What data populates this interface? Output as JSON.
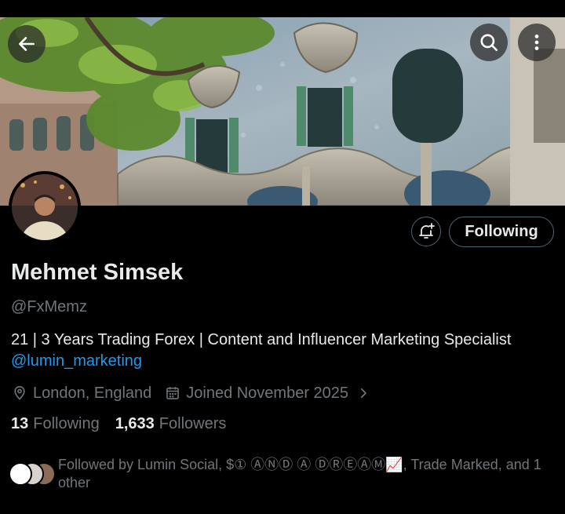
{
  "profile": {
    "name": "Mehmet Simsek",
    "handle": "@FxMemz",
    "bio": "21 | 3 Years Trading Forex | Content and Influencer Marketing Specialist",
    "bio_mention": "@lumin_marketing",
    "location": "London, England",
    "joined": "Joined November 2025",
    "following_count": "13",
    "following_label": "Following",
    "followers_count": "1,633",
    "followers_label": "Followers"
  },
  "actions": {
    "follow_state_label": "Following"
  },
  "followed_by": {
    "text": "Followed by Lumin Social, $① ⒶⓃⒹ Ⓐ ⒹⓇⒺⒶⓂ📈, Trade Marked, and 1 other"
  },
  "icons": {
    "back": "arrow-left-icon",
    "search": "search-icon",
    "more": "more-vertical-icon",
    "notify": "bell-plus-icon",
    "location": "location-pin-icon",
    "calendar": "calendar-icon",
    "expand": "chevron-right-icon"
  },
  "colors": {
    "background": "#000000",
    "text_primary": "#e7e9ea",
    "text_secondary": "#71767b",
    "link": "#1d9bf0",
    "border": "#536471"
  }
}
